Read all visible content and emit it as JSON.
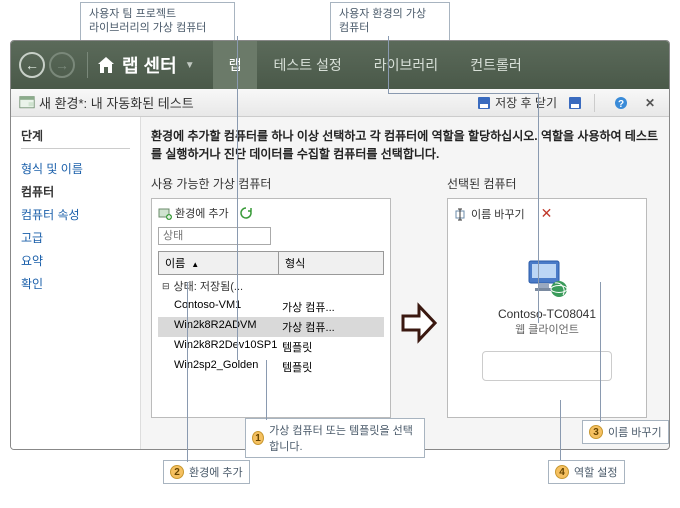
{
  "callouts": {
    "top1_l1": "사용자 팀 프로젝트",
    "top1_l2": "라이브러리의 가상 컴퓨터",
    "top2_l1": "사용자 환경의 가상",
    "top2_l2": "컴퓨터"
  },
  "nav": {
    "crumb": "랩 센터",
    "tab_lab": "랩",
    "tab_test": "테스트 설정",
    "tab_lib": "라이브러리",
    "tab_ctrl": "컨트롤러"
  },
  "toolbar": {
    "title": "새 환경*: 내 자동화된 테스트",
    "save_close": "저장 후 닫기"
  },
  "sidebar": {
    "header": "단계",
    "items": [
      "형식 및 이름",
      "컴퓨터",
      "컴퓨터 속성",
      "고급",
      "요약",
      "확인"
    ]
  },
  "instruction": "환경에 추가할 컴퓨터를 하나 이상 선택하고 각 컴퓨터에 역할을 할당하십시오. 역할을 사용하여 테스트를 실행하거나 진단 데이터를 수집할 컴퓨터를 선택합니다.",
  "left_panel": {
    "title": "사용 가능한 가상 컴퓨터",
    "add_btn": "환경에 추가",
    "search_placeholder": "상태",
    "col_name": "이름",
    "col_type": "형식",
    "group_label": "상태: 저장됨(...",
    "rows": [
      {
        "name": "Contoso-VM1",
        "type": "가상 컴퓨..."
      },
      {
        "name": "Win2k8R2ADVM",
        "type": "가상 컴퓨..."
      },
      {
        "name": "Win2k8R2Dev10SP1",
        "type": "템플릿"
      },
      {
        "name": "Win2sp2_Golden",
        "type": "템플릿"
      }
    ]
  },
  "right_panel": {
    "title": "선택된 컴퓨터",
    "rename_btn": "이름 바꾸기",
    "selected_name": "Contoso-TC08041",
    "selected_role": "웹 클라이언트"
  },
  "steps": {
    "s1": "가상 컴퓨터 또는 템플릿을 선택합니다.",
    "s2": "환경에 추가",
    "s3": "이름 바꾸기",
    "s4": "역할 설정"
  }
}
